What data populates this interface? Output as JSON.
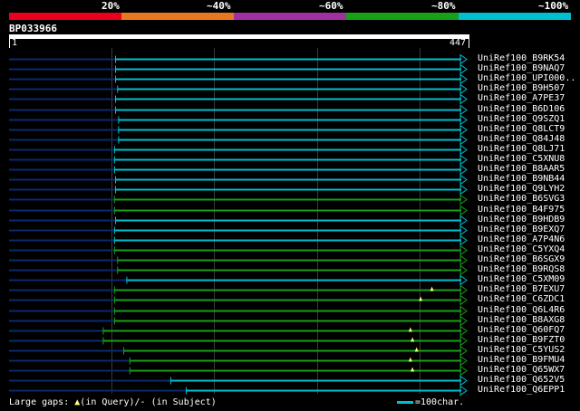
{
  "header": {
    "legend": [
      {
        "label": "",
        "color": "#e8001c"
      },
      {
        "label": "20%",
        "color": "#e87820"
      },
      {
        "label": "~40%",
        "color": "#a030a0"
      },
      {
        "label": "~60%",
        "color": "#18a018"
      },
      {
        "label": "~80%",
        "color": "#00c0d0"
      },
      {
        "label": "~100%",
        "color": ""
      }
    ],
    "query_id": "BP033966",
    "ruler_start": "1",
    "ruler_end": "447"
  },
  "colors": {
    "query_line": "#0a2a70",
    "cyan": "#00c0d0",
    "green": "#18a018",
    "grid": "#3a3a3a",
    "gap_marker": "#ffff80"
  },
  "alignment": {
    "query_length": 447,
    "hits": [
      {
        "label": "UniRef100_B9RK54",
        "start": 104,
        "end": 447,
        "color": "cyan",
        "gaps": []
      },
      {
        "label": "UniRef100_B9NAQ7",
        "start": 104,
        "end": 447,
        "color": "cyan",
        "gaps": []
      },
      {
        "label": "UniRef100_UPI000..",
        "start": 104,
        "end": 447,
        "color": "cyan",
        "gaps": []
      },
      {
        "label": "UniRef100_B9H507",
        "start": 106,
        "end": 447,
        "color": "cyan",
        "gaps": []
      },
      {
        "label": "UniRef100_A7PE37",
        "start": 104,
        "end": 447,
        "color": "cyan",
        "gaps": []
      },
      {
        "label": "UniRef100_B6D106",
        "start": 104,
        "end": 447,
        "color": "cyan",
        "gaps": []
      },
      {
        "label": "UniRef100_Q9SZQ1",
        "start": 107,
        "end": 447,
        "color": "cyan",
        "gaps": []
      },
      {
        "label": "UniRef100_Q8LCT9",
        "start": 107,
        "end": 447,
        "color": "cyan",
        "gaps": []
      },
      {
        "label": "UniRef100_Q84J48",
        "start": 107,
        "end": 447,
        "color": "cyan",
        "gaps": []
      },
      {
        "label": "UniRef100_Q8LJ71",
        "start": 103,
        "end": 447,
        "color": "cyan",
        "gaps": []
      },
      {
        "label": "UniRef100_C5XNU8",
        "start": 103,
        "end": 447,
        "color": "cyan",
        "gaps": []
      },
      {
        "label": "UniRef100_B8AAR5",
        "start": 103,
        "end": 447,
        "color": "cyan",
        "gaps": []
      },
      {
        "label": "UniRef100_B9NB44",
        "start": 104,
        "end": 447,
        "color": "cyan",
        "gaps": []
      },
      {
        "label": "UniRef100_Q9LYH2",
        "start": 104,
        "end": 447,
        "color": "cyan",
        "gaps": []
      },
      {
        "label": "UniRef100_B6SVG3",
        "start": 103,
        "end": 447,
        "color": "green",
        "gaps": []
      },
      {
        "label": "UniRef100_B4F975",
        "start": 103,
        "end": 447,
        "color": "green",
        "gaps": []
      },
      {
        "label": "UniRef100_B9HDB9",
        "start": 104,
        "end": 447,
        "color": "cyan",
        "gaps": []
      },
      {
        "label": "UniRef100_B9EXQ7",
        "start": 103,
        "end": 447,
        "color": "cyan",
        "gaps": []
      },
      {
        "label": "UniRef100_A7P4N6",
        "start": 103,
        "end": 447,
        "color": "cyan",
        "gaps": []
      },
      {
        "label": "UniRef100_C5YXQ4",
        "start": 103,
        "end": 447,
        "color": "green",
        "gaps": []
      },
      {
        "label": "UniRef100_B6SGX9",
        "start": 106,
        "end": 447,
        "color": "green",
        "gaps": []
      },
      {
        "label": "UniRef100_B9RQS8",
        "start": 106,
        "end": 447,
        "color": "green",
        "gaps": []
      },
      {
        "label": "UniRef100_C5XM09",
        "start": 115,
        "end": 447,
        "color": "cyan",
        "gaps": []
      },
      {
        "label": "UniRef100_B7EXU7",
        "start": 103,
        "end": 447,
        "color": "green",
        "gaps": [
          413
        ]
      },
      {
        "label": "UniRef100_C6ZDC1",
        "start": 103,
        "end": 447,
        "color": "green",
        "gaps": [
          402
        ]
      },
      {
        "label": "UniRef100_Q6L4R6",
        "start": 103,
        "end": 447,
        "color": "green",
        "gaps": []
      },
      {
        "label": "UniRef100_B8AXG8",
        "start": 103,
        "end": 447,
        "color": "green",
        "gaps": []
      },
      {
        "label": "UniRef100_Q60FQ7",
        "start": 92,
        "end": 447,
        "color": "green",
        "gaps": [
          392
        ]
      },
      {
        "label": "UniRef100_B9FZT0",
        "start": 92,
        "end": 447,
        "color": "green",
        "gaps": [
          394
        ]
      },
      {
        "label": "UniRef100_C5YUS2",
        "start": 112,
        "end": 447,
        "color": "green",
        "gaps": [
          398
        ]
      },
      {
        "label": "UniRef100_B9FMU4",
        "start": 118,
        "end": 447,
        "color": "green",
        "gaps": [
          392
        ]
      },
      {
        "label": "UniRef100_Q65WX7",
        "start": 118,
        "end": 447,
        "color": "green",
        "gaps": [
          394
        ]
      },
      {
        "label": "UniRef100_Q652V5",
        "start": 158,
        "end": 447,
        "color": "cyan",
        "gaps": []
      },
      {
        "label": "UniRef100_Q6EPP1",
        "start": 173,
        "end": 447,
        "color": "cyan",
        "gaps": []
      }
    ]
  },
  "footer": {
    "gaps_text": "Large gaps:",
    "gaps_query_text": "(in Query)/",
    "gaps_subject_text": "- (in Subject)",
    "gap_marker_glyph": "▲",
    "scale_text": "=100char."
  }
}
